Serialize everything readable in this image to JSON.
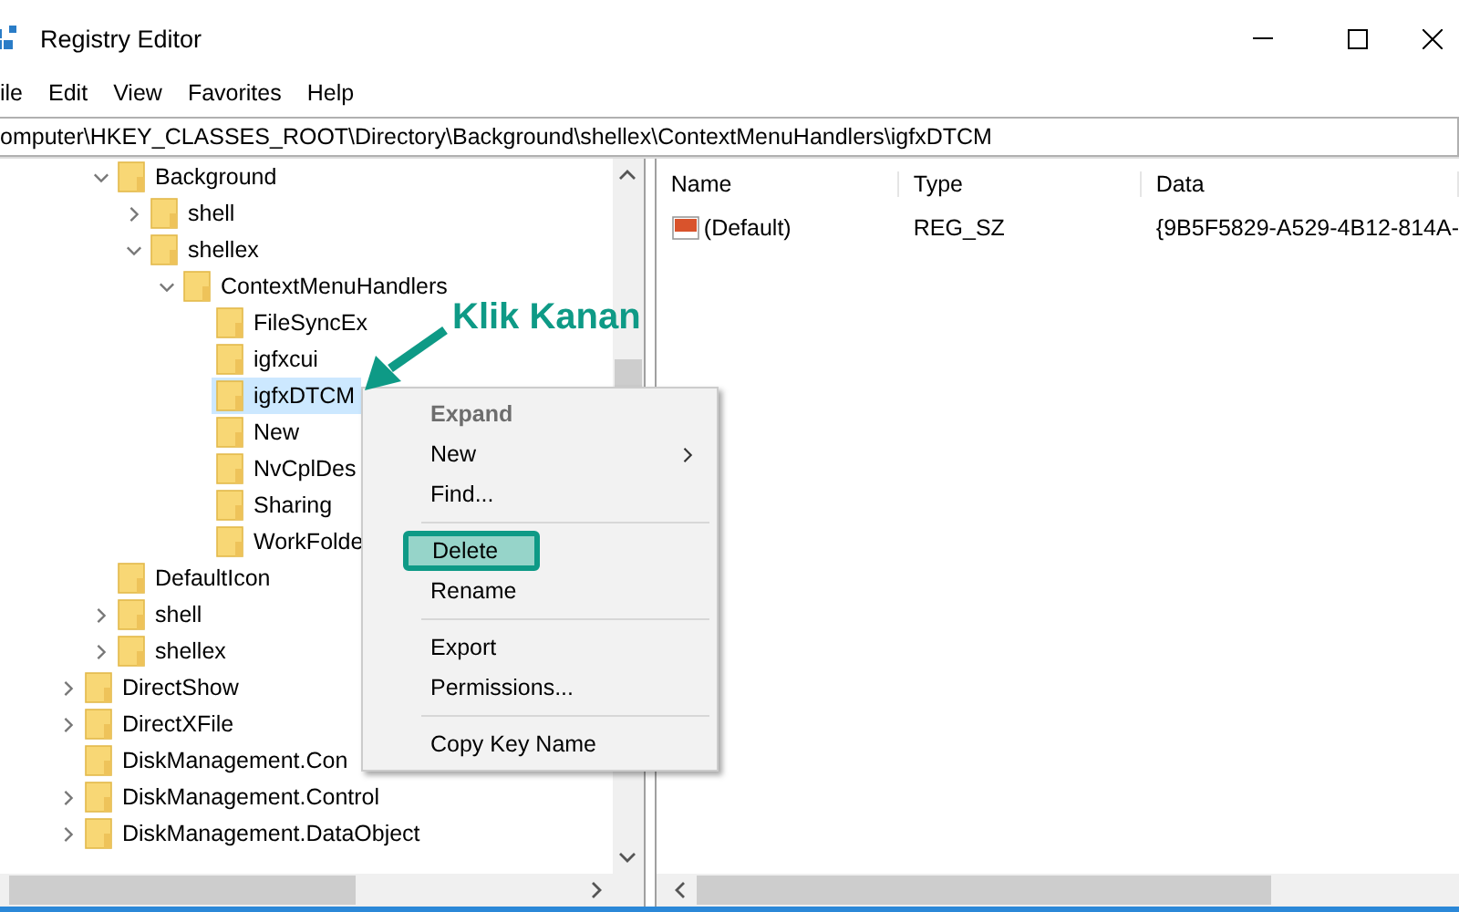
{
  "window": {
    "title": "Registry Editor"
  },
  "menu_bar": [
    "ile",
    "Edit",
    "View",
    "Favorites",
    "Help"
  ],
  "address_bar": {
    "value": "omputer\\HKEY_CLASSES_ROOT\\Directory\\Background\\shellex\\ContextMenuHandlers\\igfxDTCM"
  },
  "tree": [
    {
      "children": [
        {
          "label": "Background",
          "expanded": true,
          "selected": false,
          "children": [
            {
              "label": "shell",
              "expanded": false,
              "selected": false
            },
            {
              "label": "shellex",
              "expanded": true,
              "selected": false,
              "children": [
                {
                  "label": "ContextMenuHandlers",
                  "expanded": true,
                  "selected": false,
                  "children": [
                    {
                      "label": "FileSyncEx",
                      "selected": false
                    },
                    {
                      "label": "igfxcui",
                      "selected": false
                    },
                    {
                      "label": "igfxDTCM",
                      "selected": true
                    },
                    {
                      "label": "New",
                      "selected": false
                    },
                    {
                      "label": "NvCplDes",
                      "selected": false
                    },
                    {
                      "label": "Sharing",
                      "selected": false
                    },
                    {
                      "label": "WorkFolde",
                      "selected": false
                    }
                  ]
                }
              ]
            }
          ]
        },
        {
          "label": "DefaultIcon",
          "selected": false
        },
        {
          "label": "shell",
          "expanded": false,
          "selected": false
        },
        {
          "label": "shellex",
          "expanded": false,
          "selected": false
        }
      ]
    },
    {
      "label": "DirectShow",
      "expanded": false,
      "selected": false
    },
    {
      "label": "DirectXFile",
      "expanded": false,
      "selected": false
    },
    {
      "label": "DiskManagement.Con",
      "selected": false
    },
    {
      "label": "DiskManagement.Control",
      "expanded": false,
      "selected": false
    },
    {
      "label": "DiskManagement.DataObject",
      "expanded": false,
      "selected": false
    }
  ],
  "values_table": {
    "columns": [
      "Name",
      "Type",
      "Data"
    ],
    "rows": [
      {
        "name": "(Default)",
        "type": "REG_SZ",
        "data": "{9B5F5829-A529-4B12-814A-"
      }
    ]
  },
  "context_menu": [
    {
      "kind": "item",
      "label": "Expand",
      "default": true,
      "disabled": true,
      "submenu": false,
      "selected": false
    },
    {
      "kind": "item",
      "label": "New",
      "default": false,
      "disabled": false,
      "submenu": true,
      "selected": false
    },
    {
      "kind": "item",
      "label": "Find...",
      "default": false,
      "disabled": false,
      "submenu": false,
      "selected": false
    },
    {
      "kind": "separator"
    },
    {
      "kind": "item",
      "label": "Delete",
      "default": false,
      "disabled": false,
      "submenu": false,
      "selected": true
    },
    {
      "kind": "item",
      "label": "Rename",
      "default": false,
      "disabled": false,
      "submenu": false,
      "selected": false
    },
    {
      "kind": "separator"
    },
    {
      "kind": "item",
      "label": "Export",
      "default": false,
      "disabled": false,
      "submenu": false,
      "selected": false
    },
    {
      "kind": "item",
      "label": "Permissions...",
      "default": false,
      "disabled": false,
      "submenu": false,
      "selected": false
    },
    {
      "kind": "separator"
    },
    {
      "kind": "item",
      "label": "Copy Key Name",
      "default": false,
      "disabled": false,
      "submenu": false,
      "selected": false
    }
  ],
  "annotation": {
    "text": "Klik Kanan"
  }
}
